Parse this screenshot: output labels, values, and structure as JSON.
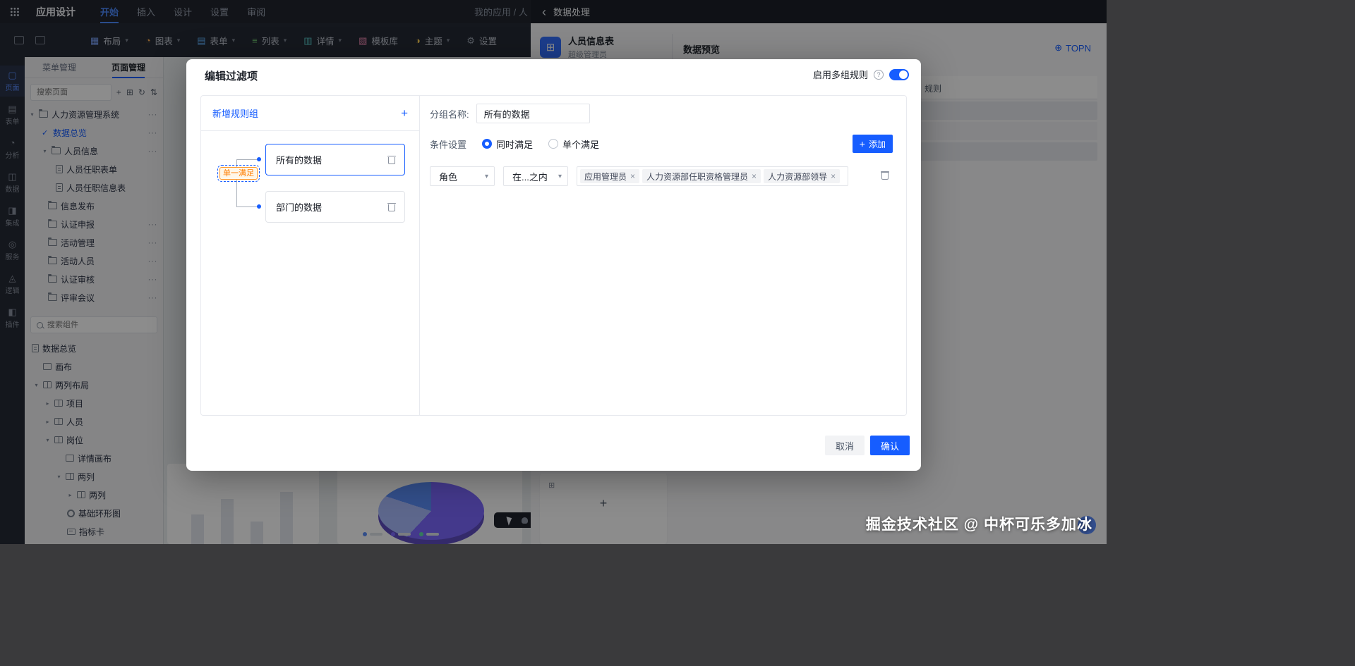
{
  "colors": {
    "primary": "#165dff",
    "badge-bg": "#fff7e8",
    "badge-border": "#ff9a2e",
    "badge-text": "#ff7d00"
  },
  "topbar": {
    "app_title": "应用设计",
    "menu_tabs": [
      {
        "label": "开始"
      },
      {
        "label": "插入"
      },
      {
        "label": "设计"
      },
      {
        "label": "设置"
      },
      {
        "label": "审阅"
      }
    ],
    "breadcrumb": "我的应用 / 人",
    "data_panel_title": "数据处理"
  },
  "toolbar": {
    "buttons": [
      {
        "label": "布局"
      },
      {
        "label": "图表"
      },
      {
        "label": "表单"
      },
      {
        "label": "列表"
      },
      {
        "label": "详情"
      },
      {
        "label": "模板库"
      },
      {
        "label": "主题"
      },
      {
        "label": "设置"
      }
    ]
  },
  "rail": {
    "items": [
      {
        "label": "页面"
      },
      {
        "label": "表单"
      },
      {
        "label": "分析"
      },
      {
        "label": "数据"
      },
      {
        "label": "集成"
      },
      {
        "label": "服务"
      },
      {
        "label": "逻辑"
      },
      {
        "label": "插件"
      }
    ]
  },
  "pages_panel": {
    "tabs": [
      {
        "label": "菜单管理"
      },
      {
        "label": "页面管理"
      }
    ],
    "search_placeholder": "搜索页面",
    "tree": [
      {
        "label": "人力资源管理系统"
      },
      {
        "label": "数据总览"
      },
      {
        "label": "人员信息"
      },
      {
        "label": "人员任职表单"
      },
      {
        "label": "人员任职信息表"
      },
      {
        "label": "信息发布"
      },
      {
        "label": "认证申报"
      },
      {
        "label": "活动管理"
      },
      {
        "label": "活动人员"
      },
      {
        "label": "认证审核"
      },
      {
        "label": "评审会议"
      }
    ],
    "component_search_placeholder": "搜索组件",
    "component_tree": [
      {
        "label": "数据总览"
      },
      {
        "label": "画布"
      },
      {
        "label": "两列布局"
      },
      {
        "label": "项目"
      },
      {
        "label": "人员"
      },
      {
        "label": "岗位"
      },
      {
        "label": "详情画布"
      },
      {
        "label": "两列"
      },
      {
        "label": "两列"
      },
      {
        "label": "基础环形图"
      },
      {
        "label": "指标卡"
      }
    ]
  },
  "data_panel": {
    "source_name": "人员信息表",
    "source_role": "超级管理员",
    "preview_title": "数据预览",
    "topn_label": "TOPN",
    "header_fragment": "规则"
  },
  "modal": {
    "title": "编辑过滤项",
    "multi_rule_label": "启用多组规则",
    "rule_groups": {
      "add_label": "新增规则组",
      "badge": "单一满足",
      "nodes": [
        {
          "label": "所有的数据"
        },
        {
          "label": "部门的数据"
        }
      ]
    },
    "form": {
      "group_name_label": "分组名称:",
      "group_name_value": "所有的数据",
      "condition_label": "条件设置",
      "radio_options": [
        {
          "label": "同时满足"
        },
        {
          "label": "单个满足"
        }
      ],
      "add_button": "添加",
      "condition_row": {
        "field": "角色",
        "operator": "在...之内",
        "values": [
          "应用管理员",
          "人力资源部任职资格管理员",
          "人力资源部领导"
        ]
      }
    },
    "footer": {
      "cancel": "取消",
      "confirm": "确认"
    }
  },
  "watermark": "掘金技术社区 @ 中杯可乐多加冰"
}
